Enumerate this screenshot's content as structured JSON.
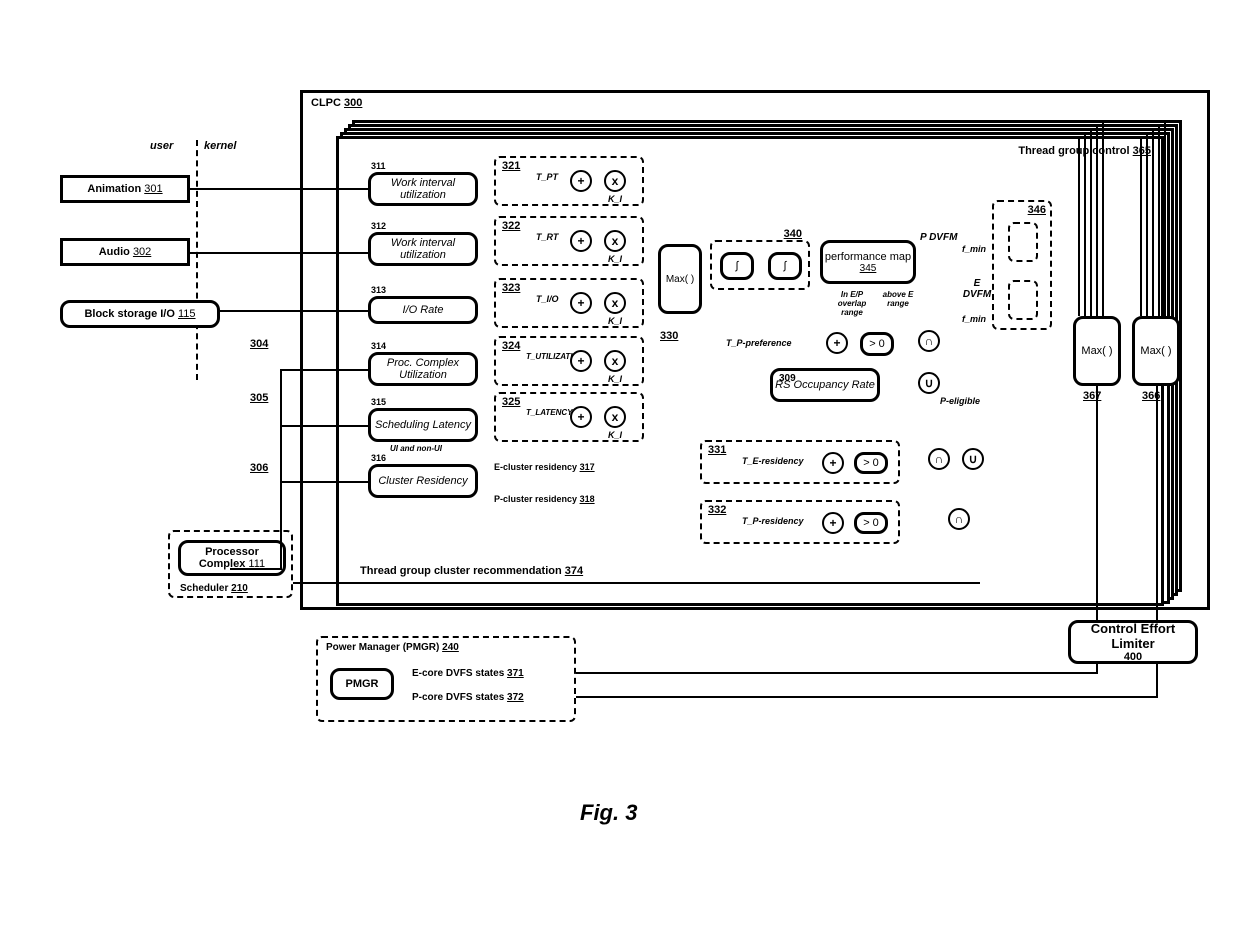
{
  "figure": {
    "caption": "Fig. 3"
  },
  "outer": {
    "clpc": {
      "title": "CLPC",
      "id": "300"
    },
    "thread_group_control": {
      "title": "Thread group control",
      "id": "365"
    }
  },
  "userkernel": {
    "user": "user",
    "kernel": "kernel"
  },
  "sources": {
    "animation": {
      "label": "Animation",
      "id": "301"
    },
    "audio": {
      "label": "Audio",
      "id": "302"
    },
    "block_io": {
      "label": "Block storage I/O",
      "id": "115"
    },
    "proc_complex": {
      "label": "Processor Complex",
      "id": "111"
    },
    "scheduler": {
      "label": "Scheduler",
      "id": "210"
    },
    "bus304": "304",
    "bus305": "305",
    "bus306": "306"
  },
  "metrics": [
    {
      "idx": 0,
      "id": "311",
      "label": "Work interval utilization"
    },
    {
      "idx": 1,
      "id": "312",
      "label": "Work interval utilization"
    },
    {
      "idx": 2,
      "id": "313",
      "label": "I/O Rate"
    },
    {
      "idx": 3,
      "id": "314",
      "label": "Proc. Complex Utilization"
    },
    {
      "idx": 4,
      "id": "315",
      "label": "Scheduling Latency"
    },
    {
      "idx": 5,
      "id": "316",
      "label": "Cluster Residency"
    }
  ],
  "metric_note": "UI and non-UI",
  "pi_blocks": [
    {
      "id": "321",
      "tvar": "T_PT",
      "kvar": "K_I"
    },
    {
      "id": "322",
      "tvar": "T_RT",
      "kvar": "K_I"
    },
    {
      "id": "323",
      "tvar": "T_I/O",
      "kvar": "K_I"
    },
    {
      "id": "324",
      "tvar": "T_UTILIZATION",
      "kvar": "K_I"
    },
    {
      "id": "325",
      "tvar": "T_LATENCY",
      "kvar": "K_I"
    }
  ],
  "max_block": {
    "label": "Max( )",
    "id": "330"
  },
  "integrators": {
    "id": "340",
    "sym1": "∫",
    "sym2": "∫"
  },
  "perf_map": {
    "label": "performance map",
    "id": "345"
  },
  "perf_map_annot": {
    "in_ep": "In E/P overlap range",
    "above_e": "above E range",
    "p_dvfm": "P DVFM",
    "e_dvfm": "E DVFM"
  },
  "mux_block": {
    "id": "346",
    "fmin": "f_min"
  },
  "rs": {
    "tp_pref": "T_P-preference",
    "rs_rate": {
      "label": "RS Occupancy Rate",
      "id": "309"
    },
    "gt0": "> 0",
    "peligible": "P-eligible"
  },
  "residency": {
    "e_clust": {
      "label": "E-cluster residency",
      "id": "317"
    },
    "p_clust": {
      "label": "P-cluster residency",
      "id": "318"
    },
    "te": "T_E-residency",
    "tp": "T_P-residency",
    "id_e": "331",
    "id_p": "332",
    "gt0": "> 0"
  },
  "recommendation": {
    "label": "Thread group cluster recommendation",
    "id": "374"
  },
  "max_out": [
    {
      "label": "Max( )",
      "id": "367"
    },
    {
      "label": "Max( )",
      "id": "366"
    }
  ],
  "cel": {
    "label": "Control Effort Limiter",
    "id": "400"
  },
  "pmgr": {
    "title": "Power Manager (PMGR)",
    "id": "240",
    "block": "PMGR",
    "e_states": {
      "label": "E-core DVFS states",
      "id": "371"
    },
    "p_states": {
      "label": "P-core DVFS states",
      "id": "372"
    }
  }
}
